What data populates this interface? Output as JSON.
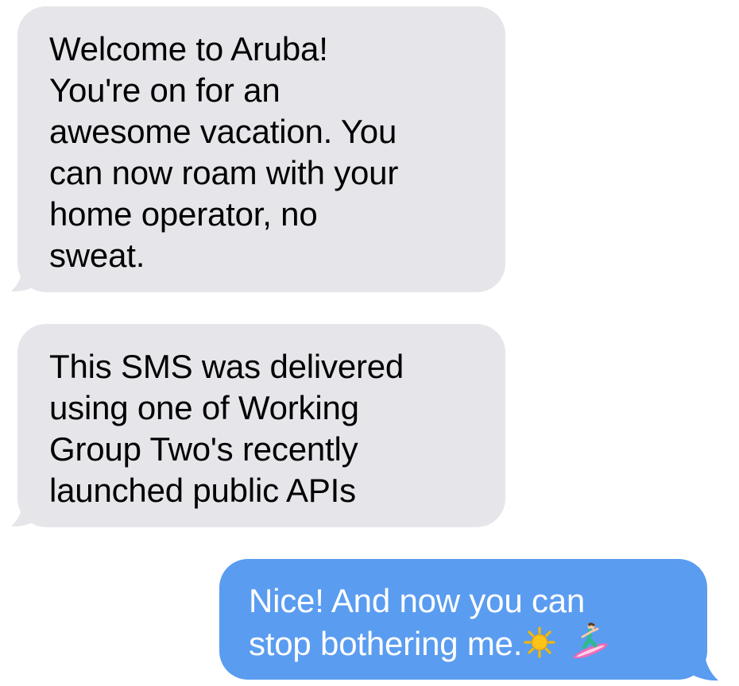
{
  "conversation": {
    "messages": [
      {
        "direction": "incoming",
        "lines": [
          "Welcome to Aruba!",
          "You're on for an",
          "awesome vacation. You",
          "can now roam with your",
          "home operator, no",
          "sweat."
        ]
      },
      {
        "direction": "incoming",
        "lines": [
          "This SMS was delivered",
          "using one of Working",
          "Group Two's recently",
          "launched public APIs"
        ]
      },
      {
        "direction": "outgoing",
        "lines": [
          "Nice! And now you can",
          "stop bothering me."
        ],
        "emojis": [
          "sun-emoji",
          "surfer-emoji"
        ]
      }
    ]
  },
  "colors": {
    "incoming_bubble": "#e5e5ea",
    "incoming_text": "#000000",
    "outgoing_bubble": "#5a9cf0",
    "outgoing_text": "#ffffff",
    "background": "#ffffff"
  }
}
